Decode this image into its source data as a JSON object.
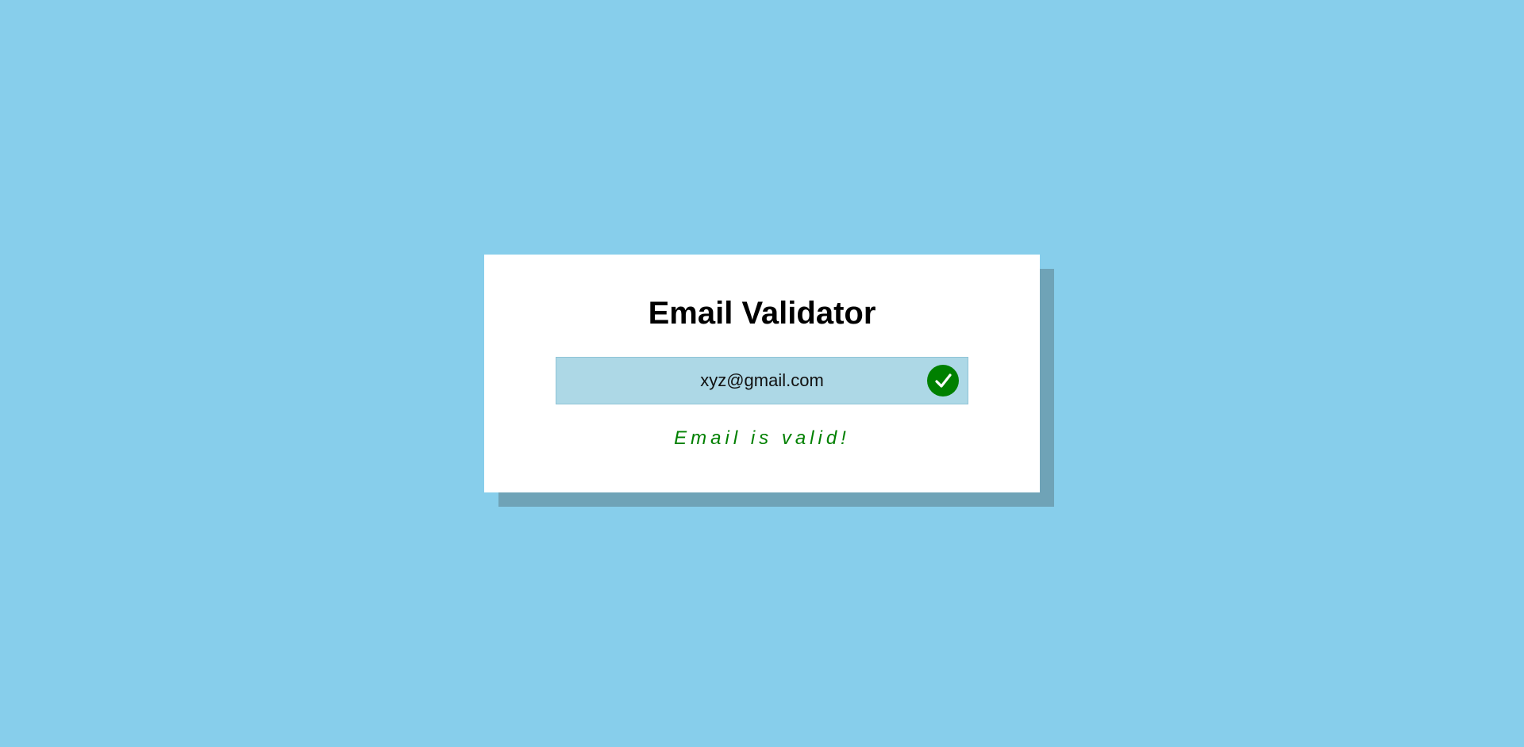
{
  "validator": {
    "title": "Email Validator",
    "email_value": "xyz@gmail.com",
    "status_text": "Email is valid!",
    "status_icon": "check-circle-icon",
    "status_color": "#008000"
  },
  "theme": {
    "background": "#87ceeb",
    "input_background": "#add8e6",
    "shadow": "#6fa3b7"
  }
}
